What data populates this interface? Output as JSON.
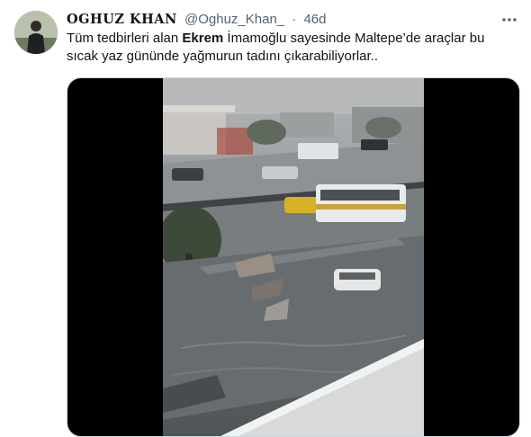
{
  "author": {
    "display_name": "OGHUZ KHAN",
    "handle": "@Oghuz_Khan_",
    "separator": "·",
    "time": "46d"
  },
  "tweet": {
    "text_part1": "Tüm tedbirleri alan ",
    "text_bold": "Ekrem",
    "text_part2": " İmamoğlu sayesinde Maltepe’de araçlar bu sıcak yaz gününde yağmurun tadını çıkarabiliyorlar.."
  },
  "icons": {
    "more": "more-dots-icon",
    "avatar": "avatar"
  }
}
